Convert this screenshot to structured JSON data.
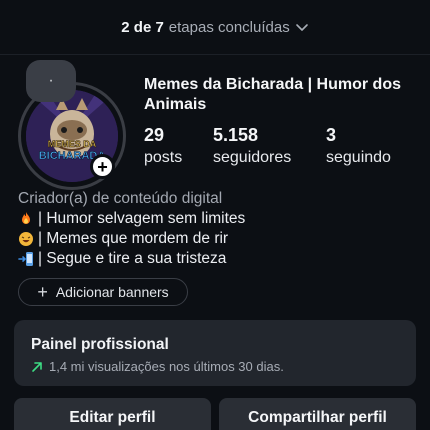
{
  "onboarding": {
    "count": "2 de 7",
    "label": "etapas concluídas"
  },
  "profile": {
    "note": "·",
    "avatar_text": [
      "MEMES DA",
      "BICHARADA"
    ],
    "name": "Memes da Bicharada | Humor dos Animais",
    "stats": {
      "posts": {
        "value": "29",
        "label": "posts"
      },
      "followers": {
        "value": "5.158",
        "label": "seguidores"
      },
      "following": {
        "value": "3",
        "label": "seguindo"
      }
    },
    "bio": {
      "category": "Criador(a) de conteúdo digital",
      "lines": [
        {
          "emoji": "fire-emoji",
          "text": "| Humor selvagem sem limites"
        },
        {
          "emoji": "laughing-emoji",
          "text": "| Memes que mordem de rir"
        },
        {
          "emoji": "phone-arrow-emoji",
          "text": "| Segue e tire a sua tristeza"
        }
      ]
    }
  },
  "banners_button": {
    "label": "Adicionar banners"
  },
  "pro_panel": {
    "title": "Painel profissional",
    "subtitle": "1,4 mi visualizações nos últimos 30 dias."
  },
  "actions": {
    "edit": "Editar perfil",
    "share": "Compartilhar perfil"
  },
  "colors": {
    "background": "#0c0f14",
    "panel": "#22262d",
    "button": "#2a2e35",
    "trend_green": "#3ddc84"
  }
}
